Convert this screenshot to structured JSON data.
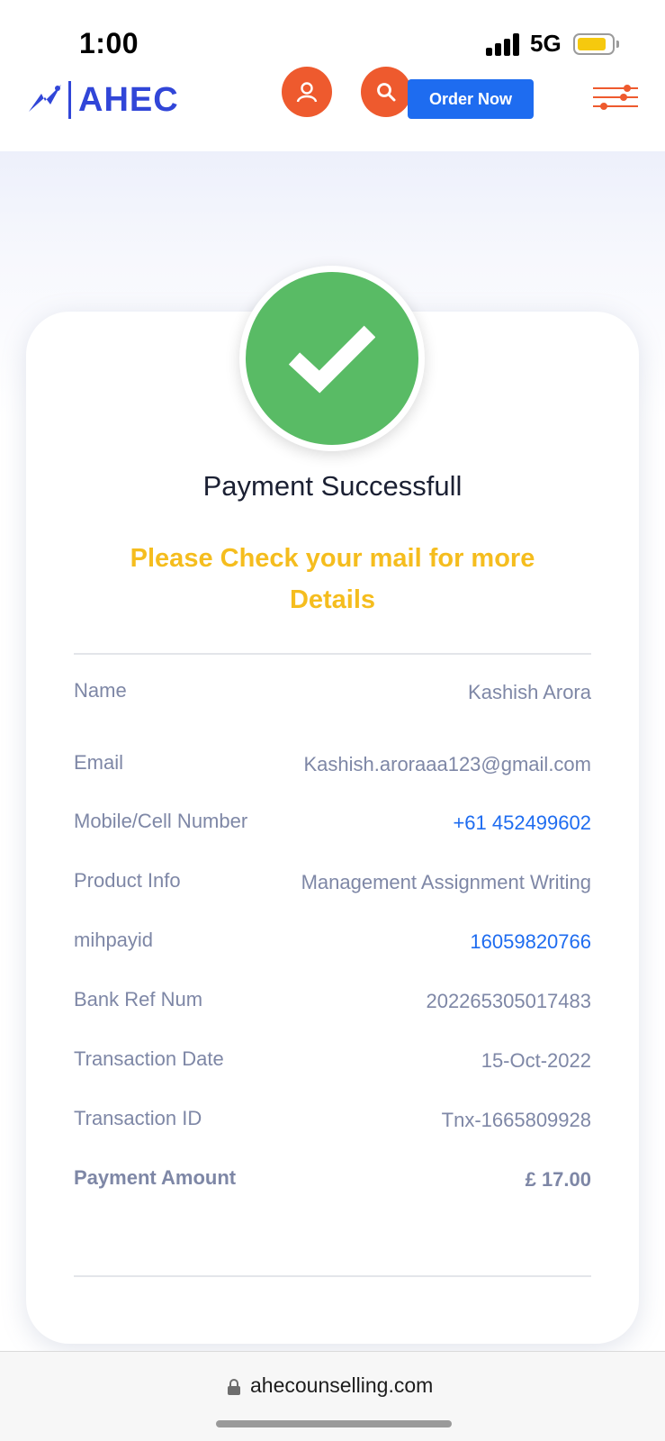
{
  "status_bar": {
    "time": "1:00",
    "network": "5G"
  },
  "header": {
    "brand": "AHEC",
    "order_button": "Order Now",
    "icons": [
      "user-icon",
      "search-icon",
      "menu-filter-icon"
    ],
    "accent_color": "#ee5a2e",
    "brand_color": "#3146d8"
  },
  "payment": {
    "status_icon": "checkmark-icon",
    "title": "Payment Successfull",
    "note": "Please Check your mail for more Details",
    "rows": [
      {
        "label": "Name",
        "value": "Kashish Arora"
      },
      {
        "label": "Email",
        "value": "Kashish.aroraaa123@gmail.com"
      },
      {
        "label": "Mobile/Cell Number",
        "value": "+61 452499602"
      },
      {
        "label": "Product Info",
        "value": "Management Assignment Writing"
      },
      {
        "label": "mihpayid",
        "value": "16059820766"
      },
      {
        "label": "Bank Ref Num",
        "value": "202265305017483"
      },
      {
        "label": "Transaction Date",
        "value": "15-Oct-2022"
      },
      {
        "label": "Transaction ID",
        "value": "Tnx-1665809928"
      },
      {
        "label": "Payment Amount",
        "value": "£ 17.00"
      }
    ]
  },
  "browser": {
    "url": "ahecounselling.com"
  }
}
